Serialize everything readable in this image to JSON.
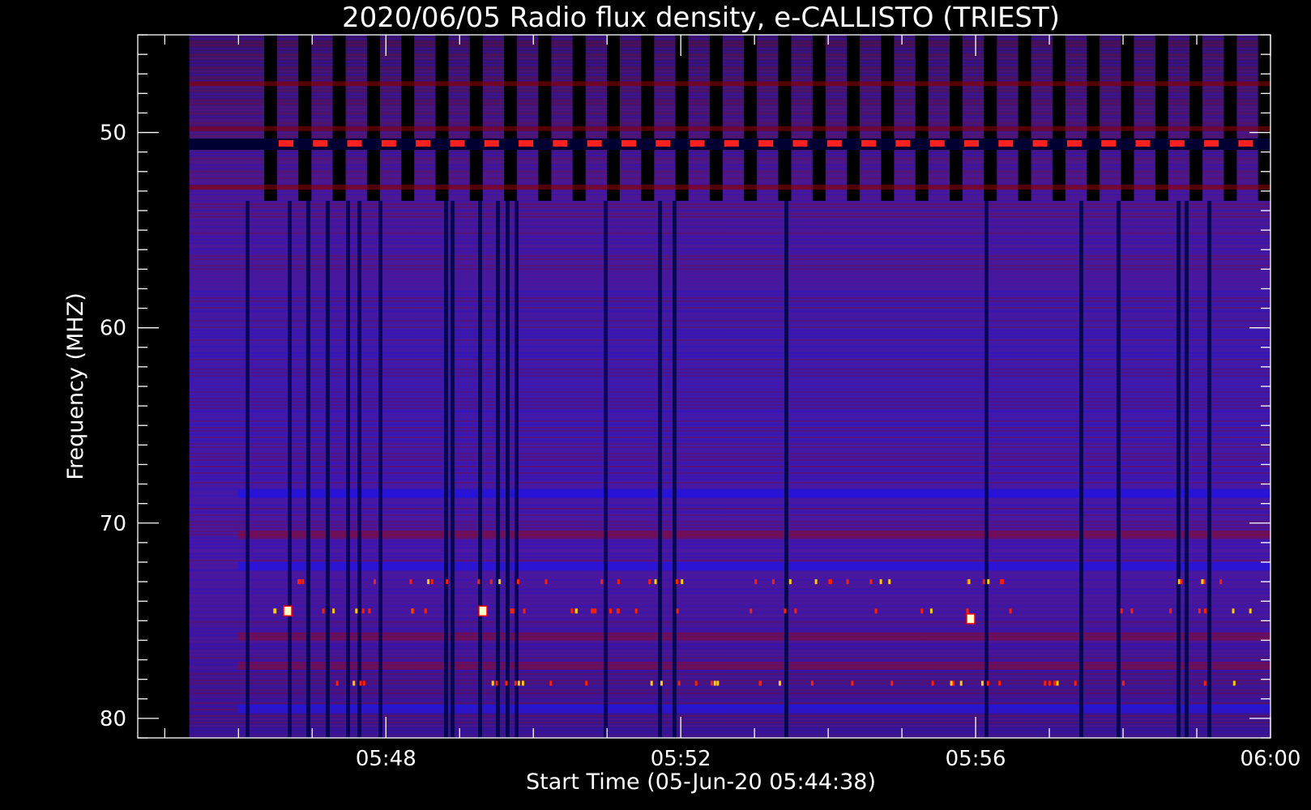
{
  "chart_data": {
    "type": "heatmap",
    "title": "2020/06/05  Radio flux density, e-CALLISTO (TRIEST)",
    "xlabel": "Start Time (05-Jun-20 05:44:38)",
    "ylabel": "Frequency (MHZ)",
    "x_unit": "UT time",
    "y_unit": "MHz",
    "xlim": [
      "05:44:38",
      "06:00:00"
    ],
    "ylim": [
      45,
      81
    ],
    "x_ticks": [
      "05:48",
      "05:52",
      "05:56",
      "06:00"
    ],
    "y_ticks": [
      50,
      60,
      70,
      80
    ],
    "y_inverted": true,
    "colormap": [
      "#000000",
      "#0000ff",
      "#8b0000",
      "#ff0000",
      "#ffff00",
      "#ffffff"
    ],
    "data_extent": {
      "time": [
        "05:45:20",
        "06:00:00"
      ],
      "frequency_mhz": [
        45,
        81
      ]
    },
    "features": {
      "narrowband_interference_mhz": 50.6,
      "gap_band_mhz": [
        45,
        53.5
      ],
      "persistent_weak_lines_mhz": [
        73,
        74.5,
        78.2
      ]
    }
  }
}
